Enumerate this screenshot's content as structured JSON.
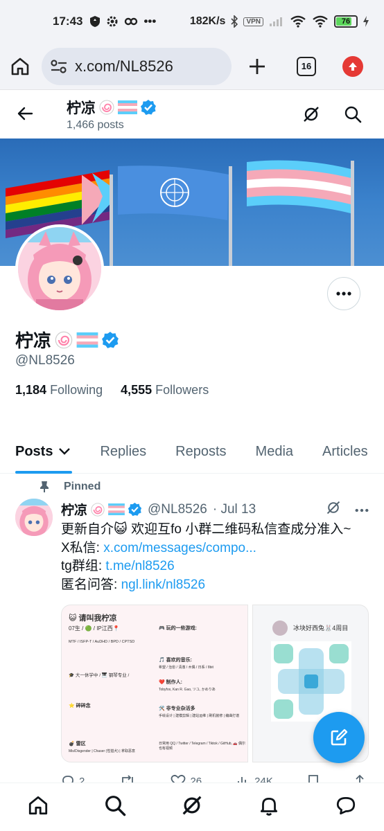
{
  "status_bar": {
    "time": "17:43",
    "dots": "•••",
    "net_speed": "182K/s",
    "vpn": "VPN",
    "battery": "76"
  },
  "browser": {
    "url": "x.com/NL8526",
    "tab_count": "16"
  },
  "header": {
    "name": "柠凉",
    "posts_count": "1,466 posts"
  },
  "profile": {
    "name": "柠凉",
    "handle": "@NL8526",
    "following_count": "1,184",
    "following_label": "Following",
    "followers_count": "4,555",
    "followers_label": "Followers"
  },
  "tabs": [
    "Posts",
    "Replies",
    "Reposts",
    "Media",
    "Articles"
  ],
  "tweet": {
    "pinned_label": "Pinned",
    "name": "柠凉",
    "handle": "@NL8526",
    "date": "· Jul 13",
    "line1": "更新自介😺 欢迎互fo 小群二维码私信查成分准入~",
    "line2_prefix": "X私信: ",
    "line2_link": "x.com/messages/compo...",
    "line3_prefix": "tg群组: ",
    "line3_link": "t.me/nl8526",
    "line4_prefix": "匿名问答: ",
    "line4_link": "ngl.link/nl8526",
    "stats": {
      "replies": "2",
      "likes": "26",
      "views": "24K"
    }
  },
  "image_card": {
    "title": "😺 请叫我柠凉",
    "sub": "07生 / 🟢 / IP江西📍",
    "mtf": "MTF / ISFP-T / AuDHD / BPD / CPTSD",
    "games_title": "🎮 玩的一些游戏:",
    "music_title": "🎵 喜欢的音乐:",
    "music": "希望 / 治愈 / 清澈 / 木偶 / 日系 / 8bit",
    "makers_title": "❤️ 制作人:",
    "makers": "Tobyfox, Kan R. Gao, ツユ, かめりあ",
    "school": "🎓 大一休学中 / 🎹 钢琴专业 /",
    "warn_title": "⭐ 碎碎念",
    "skills_title": "🛠️ 非专业杂活多",
    "skills": "手绘设计 | 建模剪辑 | 建站运维 | 刷机装修 | 编曲打谱",
    "mines_title": "💣 雷区",
    "mines": "Mis/Disgender | Chaser (性猎犬) | 拿取恶意",
    "contacts": "日常用 QQ / Twitter / Telegram / Tiktok / GitHub, 🚗 偶尔也有视频",
    "qr_name": "冰块好西兔🐰4周目"
  },
  "nav_icons": [
    "home-icon",
    "search-icon",
    "grok-icon",
    "notifications-icon",
    "messages-icon"
  ],
  "colors": {
    "accent": "#1d9bf0",
    "text": "#0f1419",
    "secondary": "#536471"
  }
}
